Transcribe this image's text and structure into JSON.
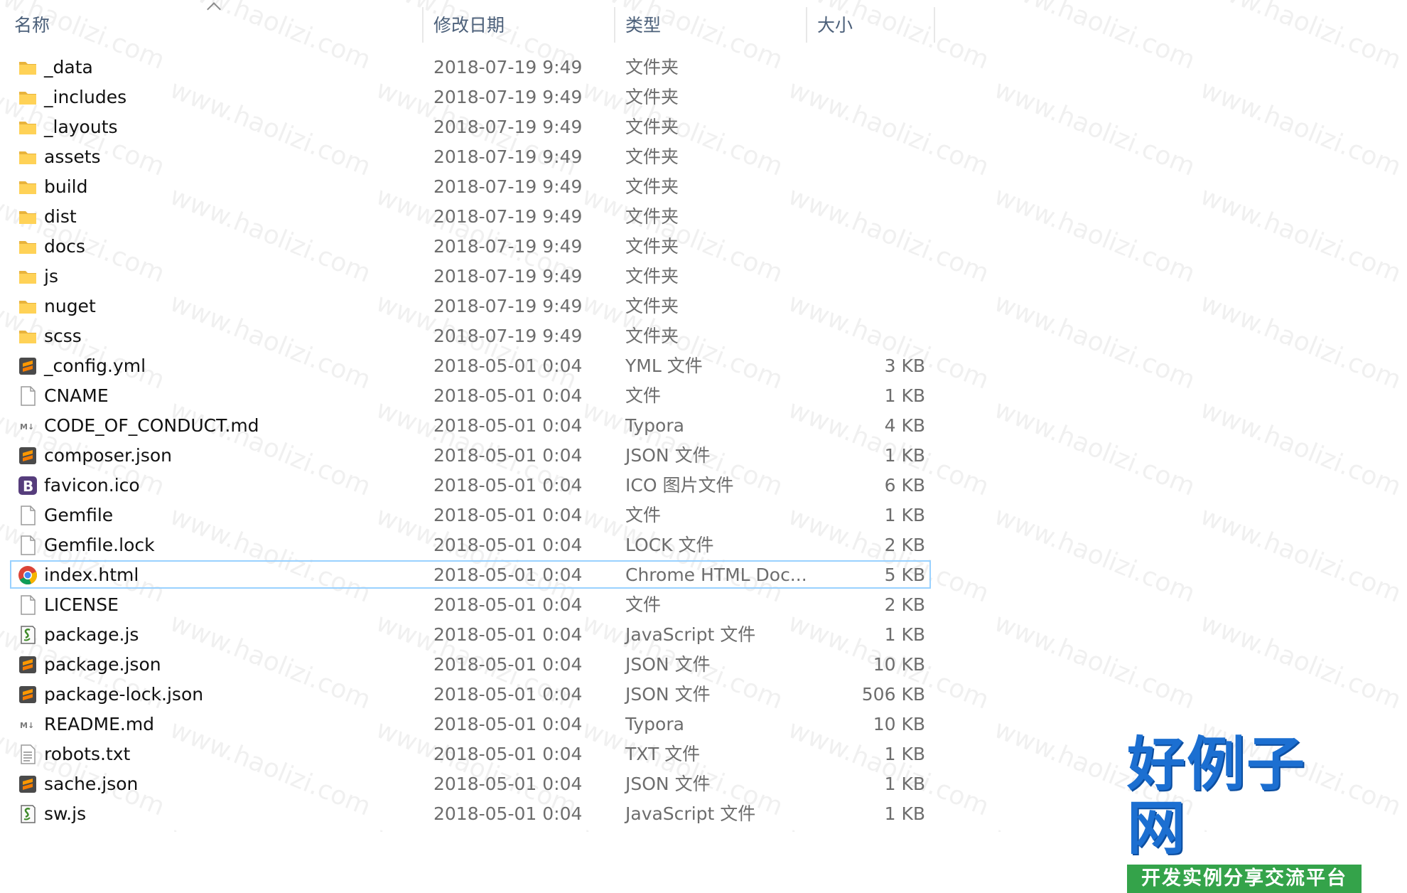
{
  "columns": {
    "name": "名称",
    "date": "修改日期",
    "type": "类型",
    "size": "大小"
  },
  "selected_file": "index.html",
  "files": [
    {
      "name": "_data",
      "date": "2018-07-19 9:49",
      "type": "文件夹",
      "size": "",
      "icon": "folder-icon"
    },
    {
      "name": "_includes",
      "date": "2018-07-19 9:49",
      "type": "文件夹",
      "size": "",
      "icon": "folder-icon"
    },
    {
      "name": "_layouts",
      "date": "2018-07-19 9:49",
      "type": "文件夹",
      "size": "",
      "icon": "folder-icon"
    },
    {
      "name": "assets",
      "date": "2018-07-19 9:49",
      "type": "文件夹",
      "size": "",
      "icon": "folder-icon"
    },
    {
      "name": "build",
      "date": "2018-07-19 9:49",
      "type": "文件夹",
      "size": "",
      "icon": "folder-icon"
    },
    {
      "name": "dist",
      "date": "2018-07-19 9:49",
      "type": "文件夹",
      "size": "",
      "icon": "folder-icon"
    },
    {
      "name": "docs",
      "date": "2018-07-19 9:49",
      "type": "文件夹",
      "size": "",
      "icon": "folder-icon"
    },
    {
      "name": "js",
      "date": "2018-07-19 9:49",
      "type": "文件夹",
      "size": "",
      "icon": "folder-icon"
    },
    {
      "name": "nuget",
      "date": "2018-07-19 9:49",
      "type": "文件夹",
      "size": "",
      "icon": "folder-icon"
    },
    {
      "name": "scss",
      "date": "2018-07-19 9:49",
      "type": "文件夹",
      "size": "",
      "icon": "folder-icon"
    },
    {
      "name": "_config.yml",
      "date": "2018-05-01 0:04",
      "type": "YML 文件",
      "size": "3 KB",
      "icon": "sublime-icon"
    },
    {
      "name": "CNAME",
      "date": "2018-05-01 0:04",
      "type": "文件",
      "size": "1 KB",
      "icon": "blank-file-icon"
    },
    {
      "name": "CODE_OF_CONDUCT.md",
      "date": "2018-05-01 0:04",
      "type": "Typora",
      "size": "4 KB",
      "icon": "markdown-icon"
    },
    {
      "name": "composer.json",
      "date": "2018-05-01 0:04",
      "type": "JSON 文件",
      "size": "1 KB",
      "icon": "sublime-icon"
    },
    {
      "name": "favicon.ico",
      "date": "2018-05-01 0:04",
      "type": "ICO 图片文件",
      "size": "6 KB",
      "icon": "bootstrap-icon"
    },
    {
      "name": "Gemfile",
      "date": "2018-05-01 0:04",
      "type": "文件",
      "size": "1 KB",
      "icon": "blank-file-icon"
    },
    {
      "name": "Gemfile.lock",
      "date": "2018-05-01 0:04",
      "type": "LOCK 文件",
      "size": "2 KB",
      "icon": "blank-file-icon"
    },
    {
      "name": "index.html",
      "date": "2018-05-01 0:04",
      "type": "Chrome HTML Doc...",
      "size": "5 KB",
      "icon": "chrome-icon"
    },
    {
      "name": "LICENSE",
      "date": "2018-05-01 0:04",
      "type": "文件",
      "size": "2 KB",
      "icon": "blank-file-icon"
    },
    {
      "name": "package.js",
      "date": "2018-05-01 0:04",
      "type": "JavaScript 文件",
      "size": "1 KB",
      "icon": "script-icon"
    },
    {
      "name": "package.json",
      "date": "2018-05-01 0:04",
      "type": "JSON 文件",
      "size": "10 KB",
      "icon": "sublime-icon"
    },
    {
      "name": "package-lock.json",
      "date": "2018-05-01 0:04",
      "type": "JSON 文件",
      "size": "506 KB",
      "icon": "sublime-icon"
    },
    {
      "name": "README.md",
      "date": "2018-05-01 0:04",
      "type": "Typora",
      "size": "10 KB",
      "icon": "markdown-icon"
    },
    {
      "name": "robots.txt",
      "date": "2018-05-01 0:04",
      "type": "TXT 文件",
      "size": "1 KB",
      "icon": "text-file-icon"
    },
    {
      "name": "sache.json",
      "date": "2018-05-01 0:04",
      "type": "JSON 文件",
      "size": "1 KB",
      "icon": "sublime-icon"
    },
    {
      "name": "sw.js",
      "date": "2018-05-01 0:04",
      "type": "JavaScript 文件",
      "size": "1 KB",
      "icon": "script-icon"
    }
  ],
  "watermark": "www.haolizi.com",
  "logo": {
    "main": "好例子网",
    "sub": "开发实例分享交流平台"
  }
}
